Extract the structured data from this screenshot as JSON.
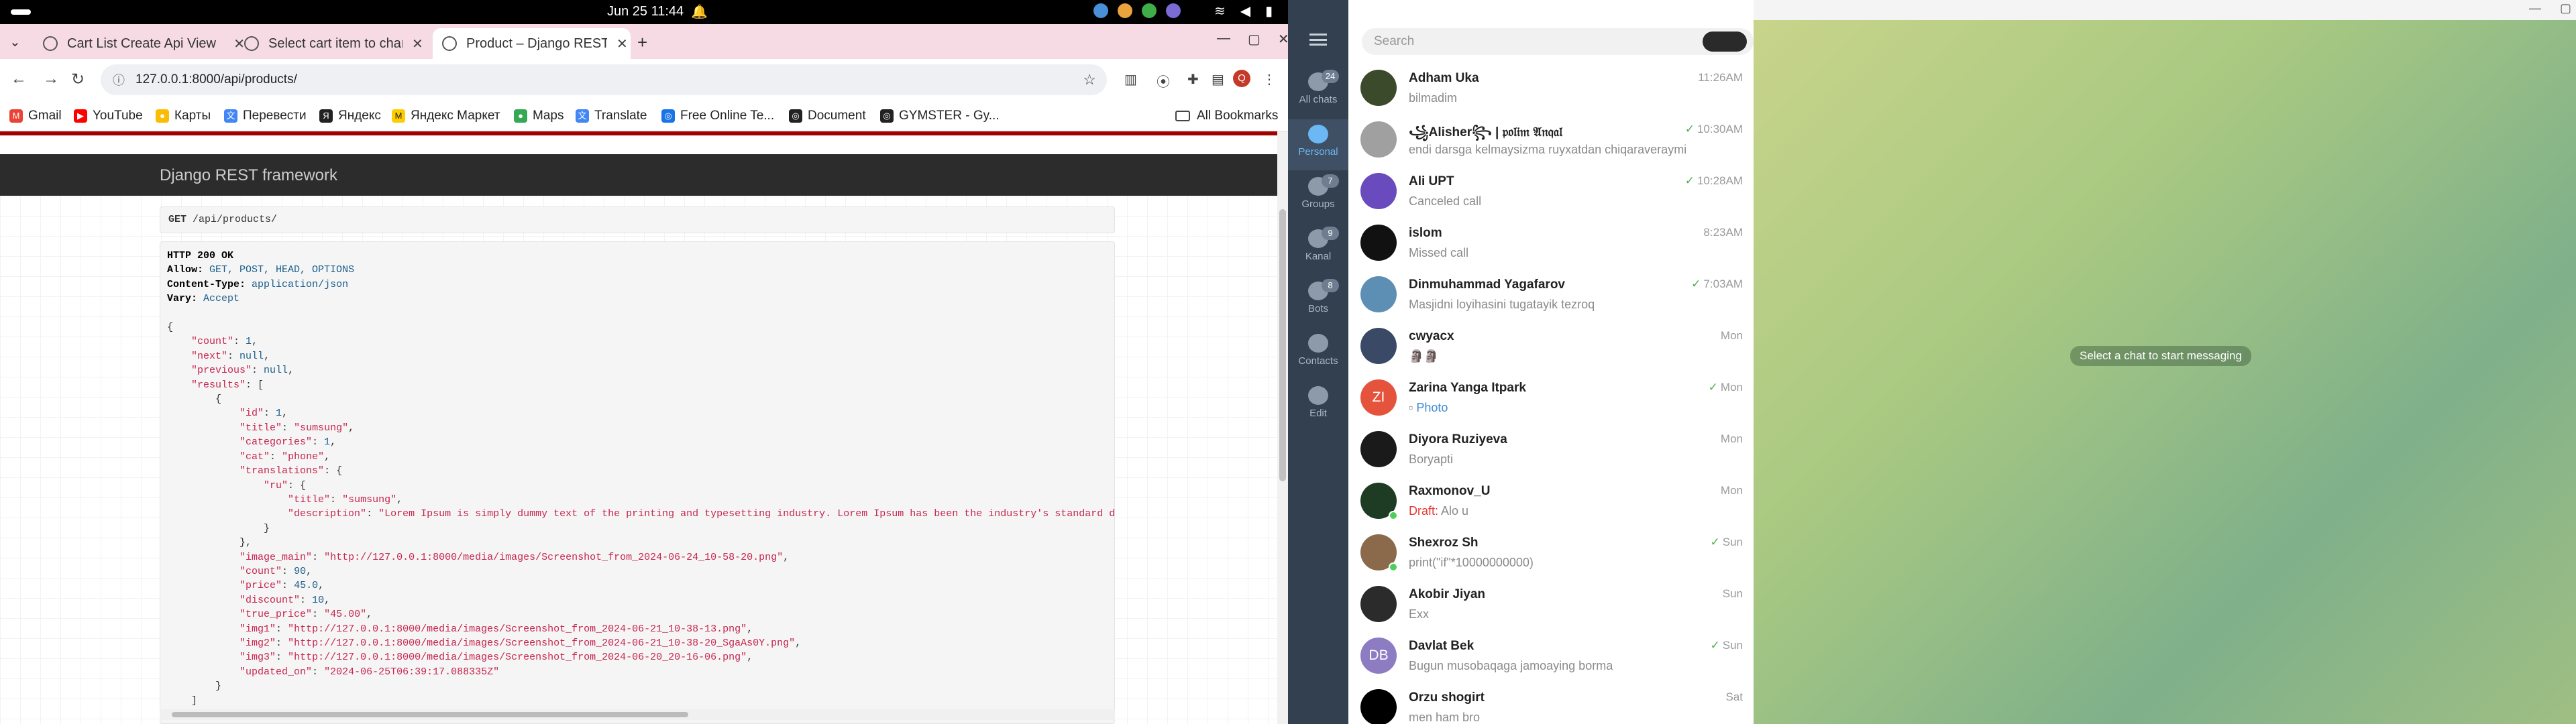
{
  "system": {
    "clock": "Jun 25  11:44"
  },
  "browser": {
    "tabs": [
      {
        "title": "Cart List Create Api View"
      },
      {
        "title": "Select cart item to change"
      },
      {
        "title": "Product – Django REST fr"
      }
    ],
    "url": "127.0.0.1:8000/api/products/",
    "profile_initial": "Q",
    "bookmarks": [
      {
        "label": "Gmail",
        "icon": "gmail-icon",
        "color": "#ea4335"
      },
      {
        "label": "YouTube",
        "icon": "youtube-icon",
        "color": "#ff0000"
      },
      {
        "label": "Карты",
        "icon": "maps-pin-icon",
        "color": "#fbbc04"
      },
      {
        "label": "Перевести",
        "icon": "translate-icon",
        "color": "#4285f4"
      },
      {
        "label": "Яндекс",
        "icon": "yandex-icon",
        "color": "#222222"
      },
      {
        "label": "Яндекс Маркет",
        "icon": "market-icon",
        "color": "#ffcc00"
      },
      {
        "label": "Maps",
        "icon": "maps-pin-icon",
        "color": "#34a853"
      },
      {
        "label": "Translate",
        "icon": "translate-icon",
        "color": "#4285f4"
      },
      {
        "label": "Free Online Te...",
        "icon": "globe-icon",
        "color": "#1a73e8"
      },
      {
        "label": "Document",
        "icon": "globe-icon",
        "color": "#222222"
      },
      {
        "label": "GYMSTER - Gy...",
        "icon": "globe-icon",
        "color": "#222222"
      }
    ],
    "all_bookmarks": "All Bookmarks"
  },
  "drf": {
    "brand": "Django REST framework",
    "request_method": "GET",
    "request_path": "/api/products/",
    "status": "HTTP 200 OK",
    "headers": [
      {
        "name": "Allow:",
        "value": "GET, POST, HEAD, OPTIONS"
      },
      {
        "name": "Content-Type:",
        "value": "application/json"
      },
      {
        "name": "Vary:",
        "value": "Accept"
      }
    ],
    "body": {
      "count": "1",
      "next": "null",
      "previous": "null",
      "id": "1",
      "title": "\"sumsung\"",
      "categories": "1",
      "cat": "\"phone\"",
      "ru_title": "\"sumsung\"",
      "ru_description": "\"Lorem Ipsum is simply dummy text of the printing and typesetting industry. Lorem Ipsum has been the industry's standard d",
      "image_main": "\"http://127.0.0.1:8000/media/images/Screenshot_from_2024-06-24_10-58-20.png\"",
      "count2": "90",
      "price": "45.0",
      "discount": "10",
      "true_price": "\"45.00\"",
      "img1": "\"http://127.0.0.1:8000/media/images/Screenshot_from_2024-06-21_10-38-13.png\"",
      "img2": "\"http://127.0.0.1:8000/media/images/Screenshot_from_2024-06-21_10-38-20_SgaAs0Y.png\"",
      "img3": "\"http://127.0.0.1:8000/media/images/Screenshot_from_2024-06-20_20-16-06.png\"",
      "updated_on": "\"2024-06-25T06:39:17.088335Z\""
    }
  },
  "telegram": {
    "search_placeholder": "Search",
    "folders": [
      {
        "label": "All chats",
        "badge": "24",
        "icon": "chats-icon"
      },
      {
        "label": "Personal",
        "badge": "",
        "icon": "person-icon"
      },
      {
        "label": "Groups",
        "badge": "7",
        "icon": "groups-icon"
      },
      {
        "label": "Kanal",
        "badge": "9",
        "icon": "channel-icon"
      },
      {
        "label": "Bots",
        "badge": "8",
        "icon": "bot-icon"
      },
      {
        "label": "Contacts",
        "badge": "",
        "icon": "contacts-icon"
      },
      {
        "label": "Edit",
        "badge": "",
        "icon": "edit-icon"
      }
    ],
    "chats": [
      {
        "name": "Adham Uka",
        "preview": "bilmadim",
        "time": "11:26AM",
        "check": "",
        "avatar_color": "#3b4a2a",
        "initials": ""
      },
      {
        "name": "꧁Alisher꧂ | 𝔭𝔬𝔩𝔦𝔪 𝔄𝔫𝔮𝔞𝔩",
        "preview": "endi darsga kelmaysizma ruyxatdan chiqaraveraymi",
        "time": "10:30AM",
        "check": "✓",
        "avatar_color": "#a0a0a0",
        "initials": ""
      },
      {
        "name": "Ali UPT",
        "preview": "Canceled call",
        "time": "10:28AM",
        "check": "✓",
        "avatar_color": "#6a4bbd",
        "initials": ""
      },
      {
        "name": "islom",
        "preview": "Missed call",
        "time": "8:23AM",
        "check": "",
        "avatar_color": "#111111",
        "initials": ""
      },
      {
        "name": "Dinmuhammad Yagafarov",
        "preview": "Masjidni loyihasini tugatayik tezroq",
        "time": "7:03AM",
        "check": "✓",
        "avatar_color": "#5d8fb5",
        "initials": ""
      },
      {
        "name": "сwyacx",
        "preview": "🗿🗿",
        "time": "Mon",
        "check": "",
        "avatar_color": "#3a4a66",
        "initials": ""
      },
      {
        "name": "Zarina Yanga Itpark",
        "preview": "Photo",
        "time": "Mon",
        "check": "✓",
        "avatar_color": "#e5533d",
        "initials": "ZI"
      },
      {
        "name": "Diyora Ruziyeva",
        "preview": "Boryapti",
        "time": "Mon",
        "check": "",
        "avatar_color": "#1a1a1a",
        "initials": ""
      },
      {
        "name": "Raxmonov_U",
        "preview": "Alo u",
        "draft": "Draft:",
        "time": "Mon",
        "check": "",
        "avatar_color": "#1e3b24",
        "initials": ""
      },
      {
        "name": "Shexroz Sh",
        "preview": "print(\"if\"*10000000000)",
        "time": "Sun",
        "check": "✓",
        "avatar_color": "#8a6a4a",
        "initials": ""
      },
      {
        "name": "Akobir Jiyan",
        "preview": "Exx",
        "time": "Sun",
        "check": "",
        "avatar_color": "#2b2b2b",
        "initials": ""
      },
      {
        "name": "Davlat Bek",
        "preview": "Bugun musobaqaga jamoaying borma",
        "time": "Sun",
        "check": "✓",
        "avatar_color": "#8e7cc3",
        "initials": "DB"
      },
      {
        "name": "Orzu shogirt",
        "preview": "men ham bro",
        "time": "Sat",
        "check": "",
        "avatar_color": "#000000",
        "initials": ""
      }
    ],
    "empty_hint": "Select a chat to start messaging"
  }
}
